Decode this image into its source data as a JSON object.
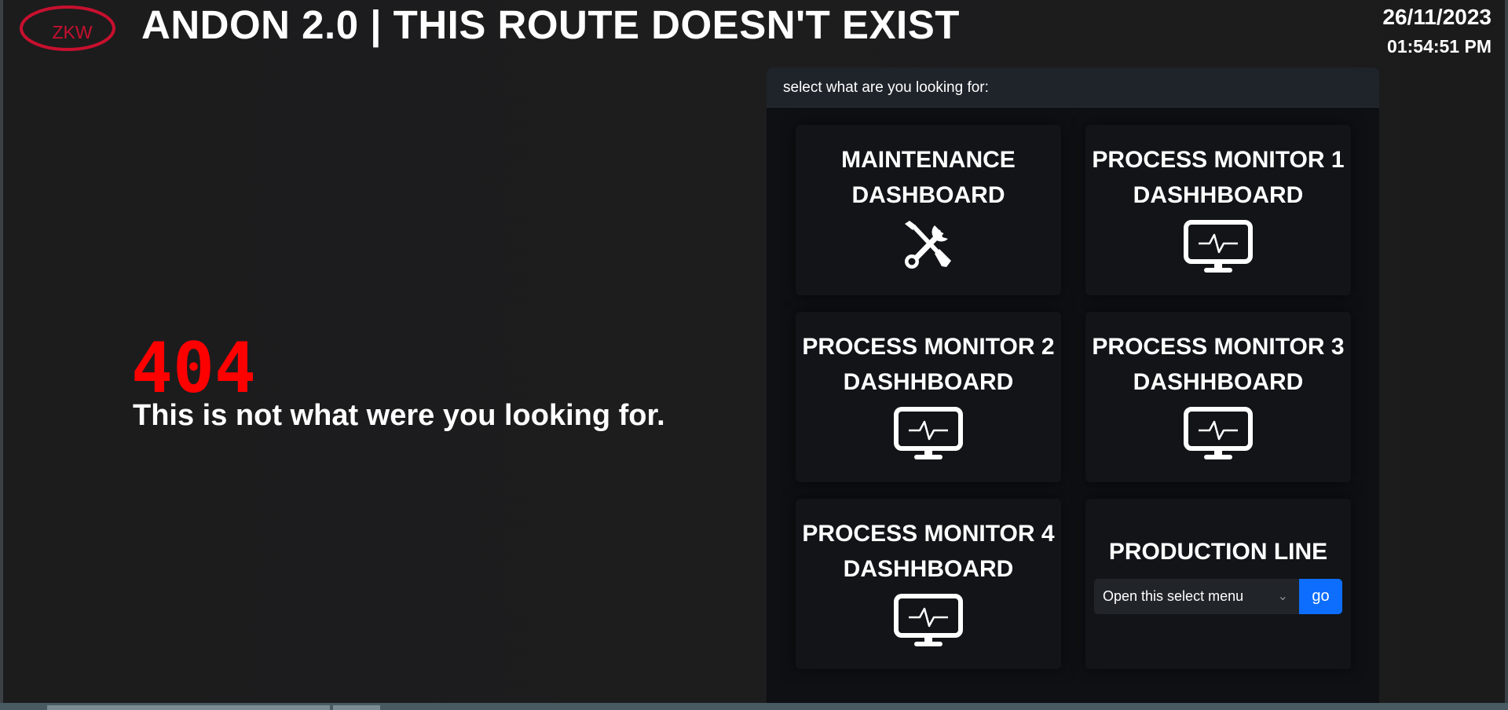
{
  "header": {
    "logo_text": "ZKW",
    "title": "ANDON 2.0 | THIS ROUTE DOESN'T EXIST",
    "date": "26/11/2023",
    "time": "01:54:51 PM"
  },
  "error": {
    "code": "404",
    "message": "This is not what were you looking for."
  },
  "panel": {
    "header": "select what are you looking for:",
    "cards": [
      {
        "title_line1": "MAINTENANCE",
        "title_line2": "DASHBOARD",
        "icon": "tools-icon"
      },
      {
        "title_line1": "PROCESS MONITOR 1",
        "title_line2": "DASHHBOARD",
        "icon": "monitor-icon"
      },
      {
        "title_line1": "PROCESS MONITOR 2",
        "title_line2": "DASHHBOARD",
        "icon": "monitor-icon"
      },
      {
        "title_line1": "PROCESS MONITOR 3",
        "title_line2": "DASHHBOARD",
        "icon": "monitor-icon"
      },
      {
        "title_line1": "PROCESS MONITOR 4",
        "title_line2": "DASHHBOARD",
        "icon": "monitor-icon"
      }
    ],
    "production_line": {
      "title": "PRODUCTION LINE",
      "select_value": "Open this select menu",
      "go_label": "go"
    }
  },
  "colors": {
    "error_red": "#ff0000",
    "logo_red": "#c8102e",
    "button_blue": "#0d6efd"
  }
}
